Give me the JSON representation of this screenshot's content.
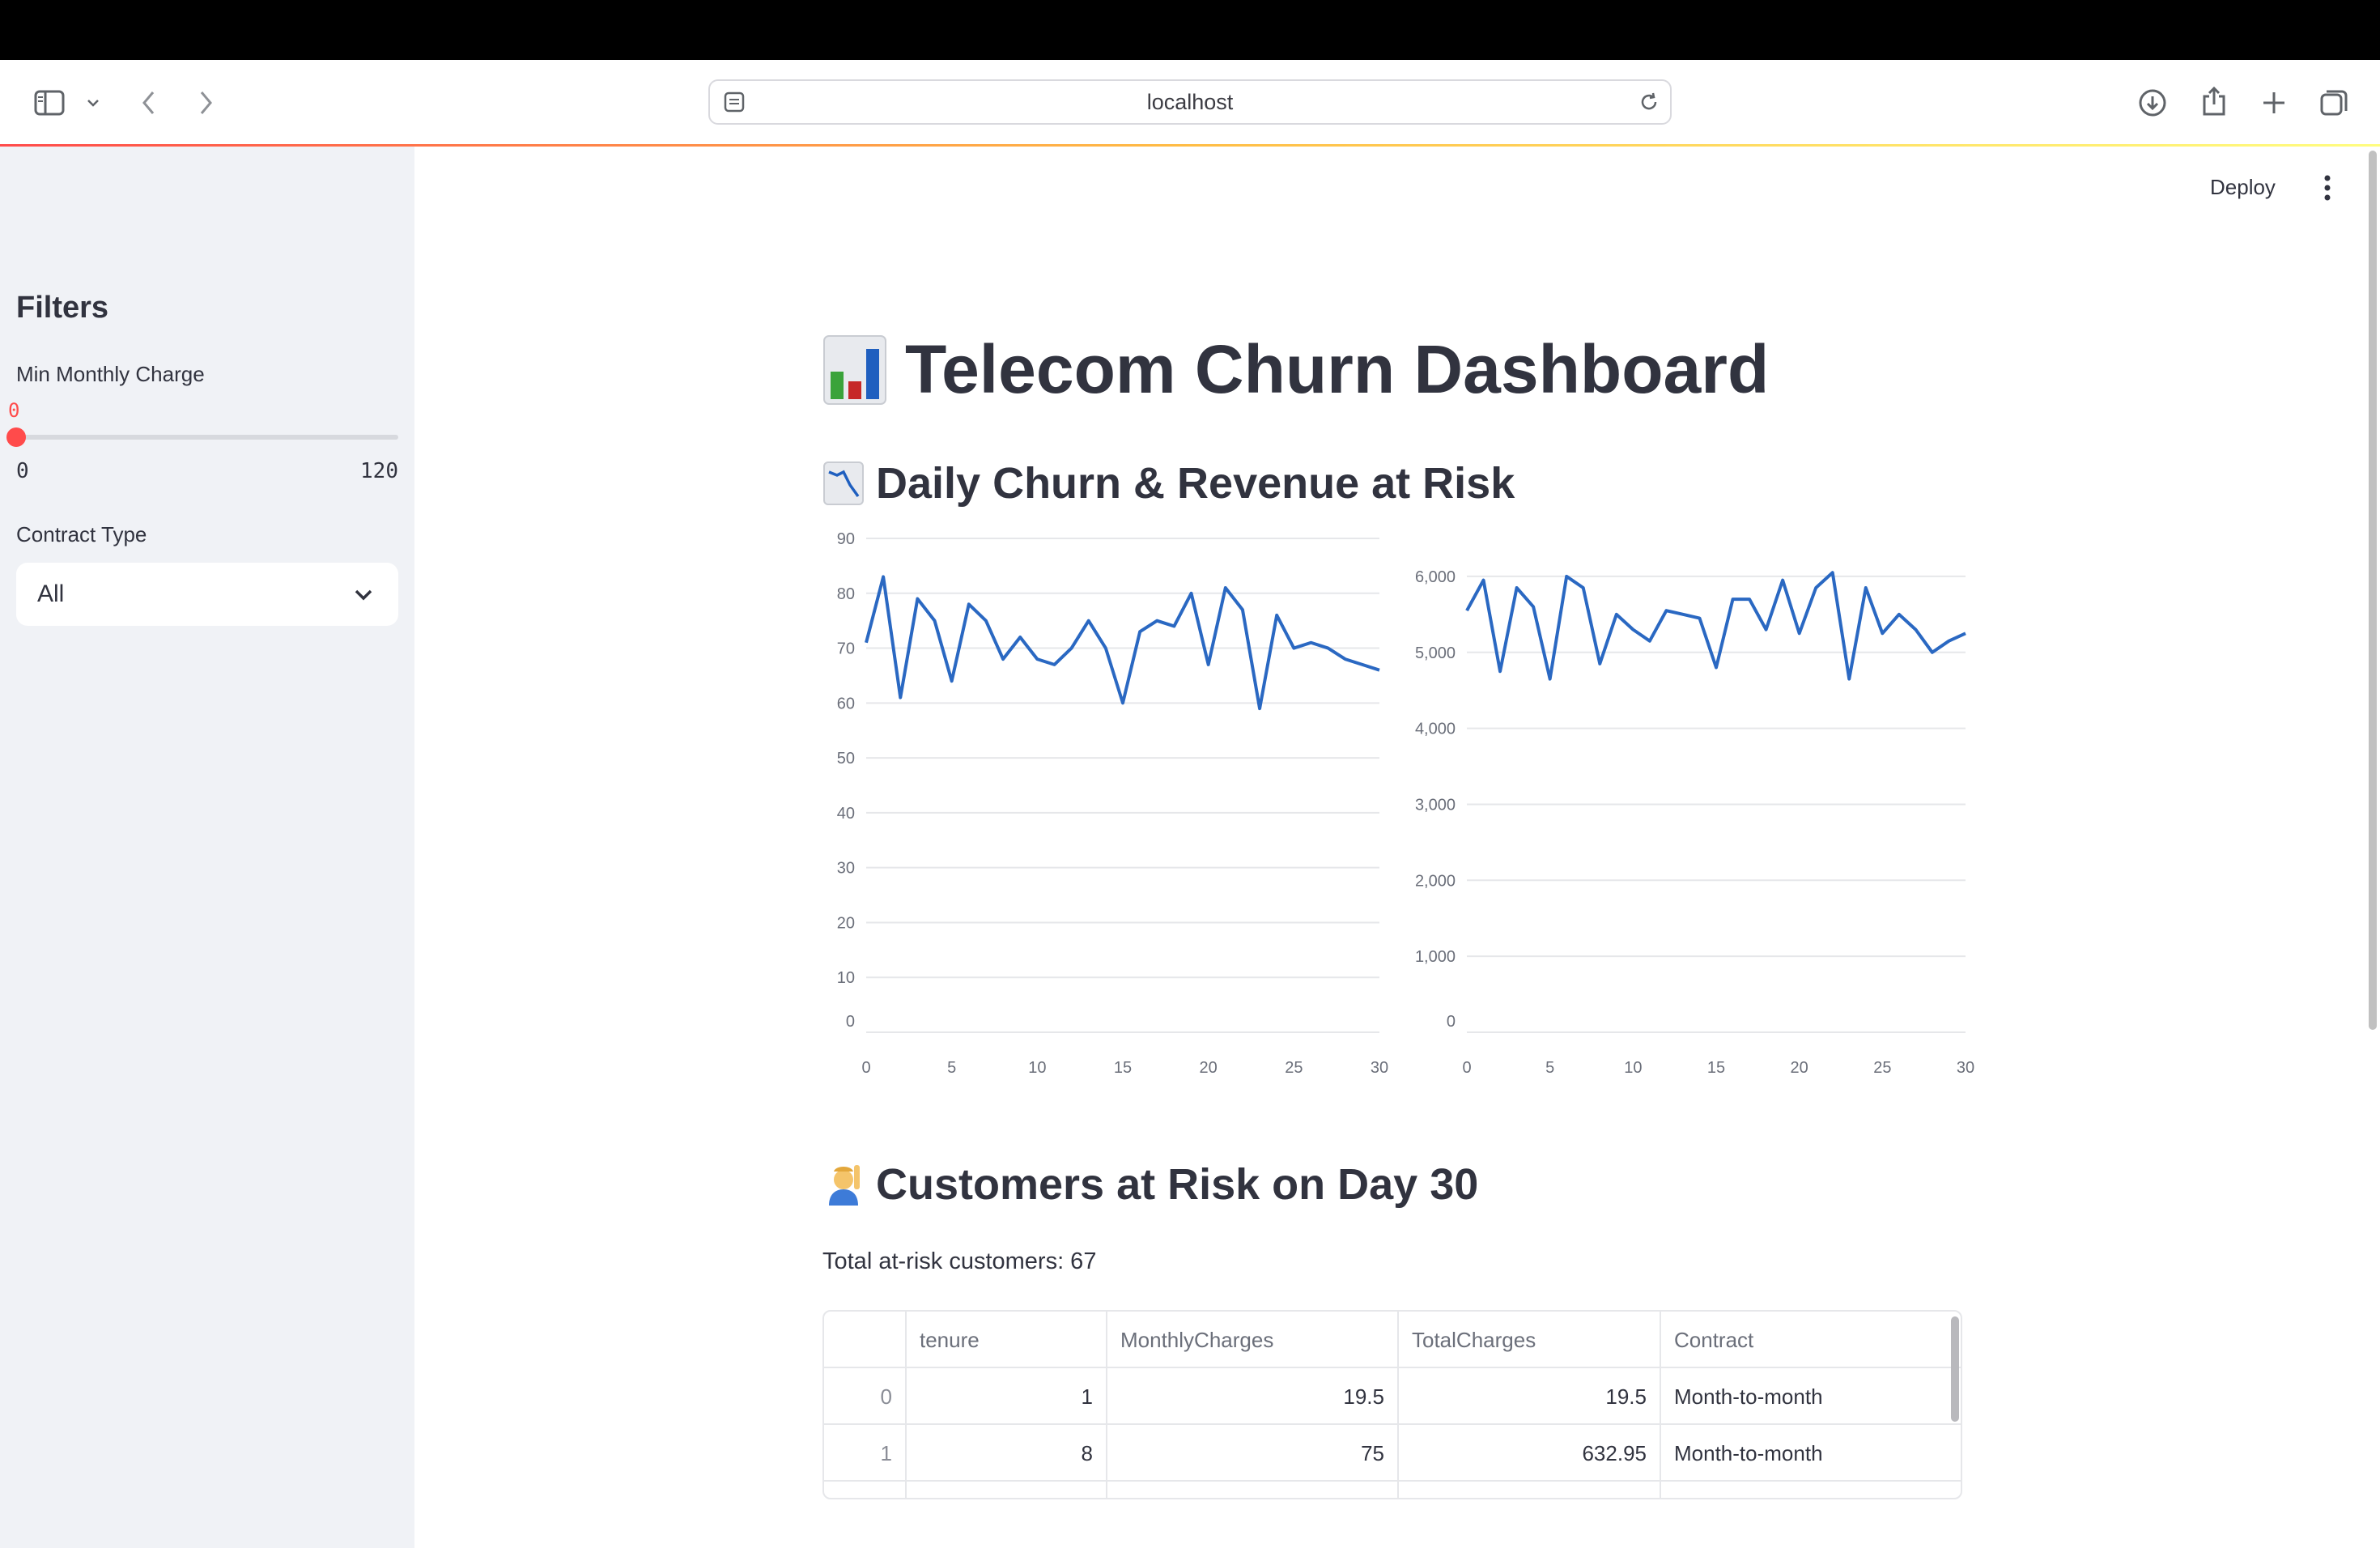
{
  "browser": {
    "url": "localhost"
  },
  "toolbar": {
    "deploy_label": "Deploy"
  },
  "sidebar": {
    "title": "Filters",
    "slider": {
      "label": "Min Monthly Charge",
      "value": "0",
      "min": "0",
      "max": "120",
      "fraction": 0
    },
    "contract": {
      "label": "Contract Type",
      "value": "All"
    }
  },
  "main": {
    "title": "Telecom Churn Dashboard",
    "title_icon": "bar-chart-emoji",
    "section1": {
      "title": "Daily Churn & Revenue at Risk",
      "icon": "chart-decreasing-emoji"
    },
    "section2": {
      "title": "Customers at Risk on Day 30",
      "icon": "person-raising-hand-emoji"
    },
    "total_at_risk": "Total at-risk customers: 67"
  },
  "table": {
    "columns": [
      "",
      "tenure",
      "MonthlyCharges",
      "TotalCharges",
      "Contract"
    ],
    "rows": [
      [
        "0",
        "1",
        "19.5",
        "19.5",
        "Month-to-month"
      ],
      [
        "1",
        "8",
        "75",
        "632.95",
        "Month-to-month"
      ]
    ]
  },
  "colors": {
    "accent": "#ff4b4b",
    "line": "#2a68c2",
    "sidebar_bg": "#f0f2f6",
    "text": "#31333f"
  },
  "chart_data": [
    {
      "type": "line",
      "title": "",
      "xlabel": "",
      "ylabel": "",
      "xlim": [
        0,
        30
      ],
      "ylim": [
        0,
        90
      ],
      "x_ticks": [
        0,
        5,
        10,
        15,
        20,
        25,
        30
      ],
      "y_ticks": [
        0,
        10,
        20,
        30,
        40,
        50,
        60,
        70,
        80,
        90
      ],
      "y_tick_labels": [
        "0",
        "10",
        "20",
        "30",
        "40",
        "50",
        "60",
        "70",
        "80",
        "90"
      ],
      "grid": true,
      "series": [
        {
          "x": [
            0,
            1,
            2,
            3,
            4,
            5,
            6,
            7,
            8,
            9,
            10,
            11,
            12,
            13,
            14,
            15,
            16,
            17,
            18,
            19,
            20,
            21,
            22,
            23,
            24,
            25,
            26,
            27,
            28,
            29,
            30
          ],
          "values": [
            71,
            83,
            61,
            79,
            75,
            64,
            78,
            75,
            68,
            72,
            68,
            67,
            70,
            75,
            70,
            60,
            73,
            75,
            74,
            80,
            67,
            81,
            77,
            59,
            76,
            70,
            71,
            70,
            68,
            67,
            66
          ]
        }
      ]
    },
    {
      "type": "line",
      "title": "",
      "xlabel": "",
      "ylabel": "",
      "xlim": [
        0,
        30
      ],
      "ylim": [
        0,
        6500
      ],
      "x_ticks": [
        0,
        5,
        10,
        15,
        20,
        25,
        30
      ],
      "y_ticks": [
        0,
        1000,
        2000,
        3000,
        4000,
        5000,
        6000
      ],
      "y_tick_labels": [
        "0",
        "1,000",
        "2,000",
        "3,000",
        "4,000",
        "5,000",
        "6,000"
      ],
      "grid": true,
      "series": [
        {
          "x": [
            0,
            1,
            2,
            3,
            4,
            5,
            6,
            7,
            8,
            9,
            10,
            11,
            12,
            13,
            14,
            15,
            16,
            17,
            18,
            19,
            20,
            21,
            22,
            23,
            24,
            25,
            26,
            27,
            28,
            29,
            30
          ],
          "values": [
            5550,
            5950,
            4750,
            5850,
            5600,
            4650,
            6000,
            5850,
            4850,
            5500,
            5300,
            5150,
            5550,
            5500,
            5450,
            4800,
            5700,
            5700,
            5300,
            5950,
            5250,
            5850,
            6050,
            4650,
            5850,
            5250,
            5500,
            5300,
            5000,
            5150,
            5250
          ]
        }
      ]
    }
  ]
}
